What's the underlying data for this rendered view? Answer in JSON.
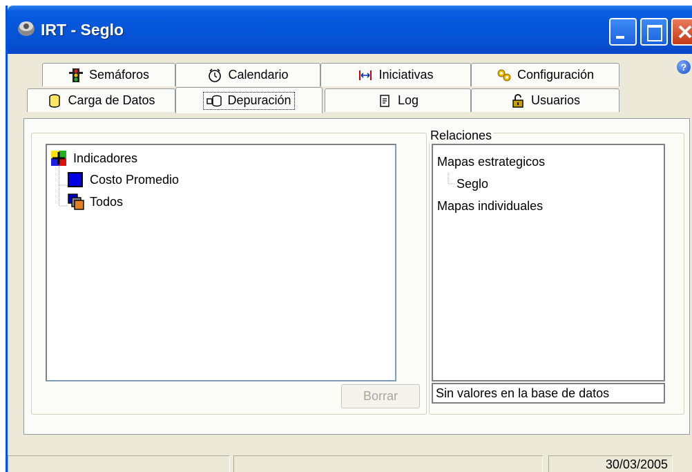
{
  "window": {
    "title": "IRT - Seglo"
  },
  "tabs": {
    "row1": [
      {
        "label": "Semáforos",
        "icon": "traffic-light-icon"
      },
      {
        "label": "Calendario",
        "icon": "clock-icon"
      },
      {
        "label": "Iniciativas",
        "icon": "arrows-icon"
      },
      {
        "label": "Configuración",
        "icon": "gears-icon"
      }
    ],
    "row2": [
      {
        "label": "Carga de Datos",
        "icon": "cylinder-icon"
      },
      {
        "label": "Depuración",
        "icon": "database-cleanup-icon",
        "active": true
      },
      {
        "label": "Log",
        "icon": "document-icon"
      },
      {
        "label": "Usuarios",
        "icon": "padlock-icon"
      }
    ]
  },
  "left_tree": {
    "root": "Indicadores",
    "children": [
      "Costo Promedio",
      "Todos"
    ]
  },
  "relaciones": {
    "title": "Relaciones",
    "items": [
      "Mapas estrategicos",
      "Seglo",
      "Mapas individuales"
    ],
    "status_text": "Sin valores en la base de datos"
  },
  "buttons": {
    "borrar": "Borrar"
  },
  "statusbar": {
    "date": "30/03/2005"
  }
}
